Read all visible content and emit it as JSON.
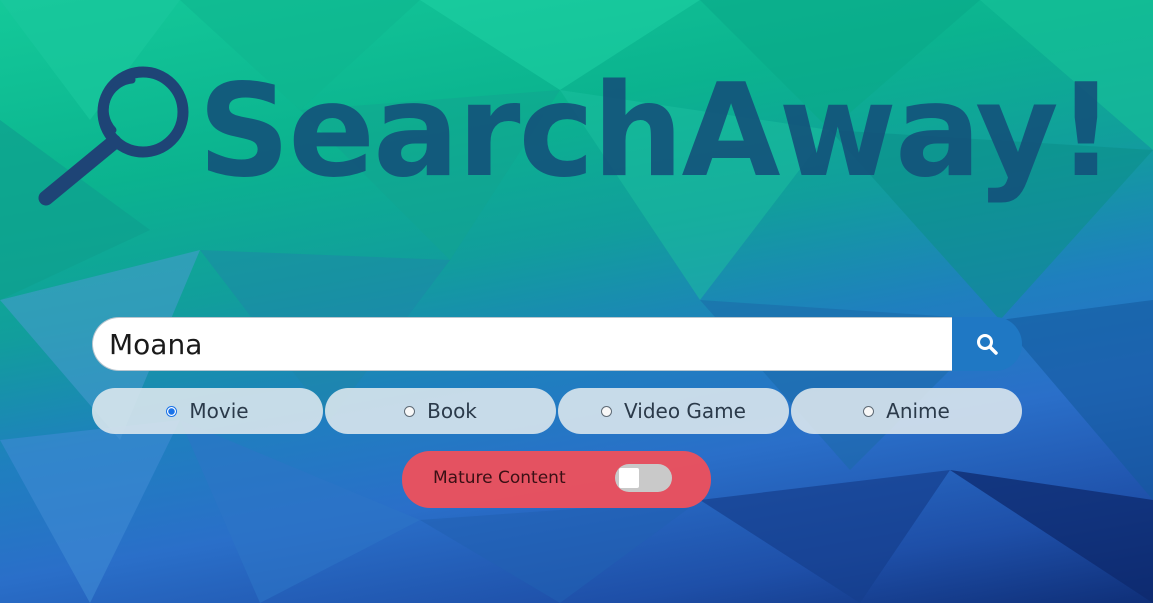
{
  "app": {
    "logo_text": "SearchAway!"
  },
  "search": {
    "value": "Moana",
    "button_icon": "search-icon"
  },
  "categories": [
    {
      "label": "Movie",
      "checked": true
    },
    {
      "label": "Book",
      "checked": false
    },
    {
      "label": "Video Game",
      "checked": false
    },
    {
      "label": "Anime",
      "checked": false
    }
  ],
  "mature": {
    "label": "Mature Content",
    "enabled": false
  },
  "colors": {
    "search_button": "#1f78c4",
    "mature_box": "#ee505c",
    "logo": "#13507a"
  }
}
